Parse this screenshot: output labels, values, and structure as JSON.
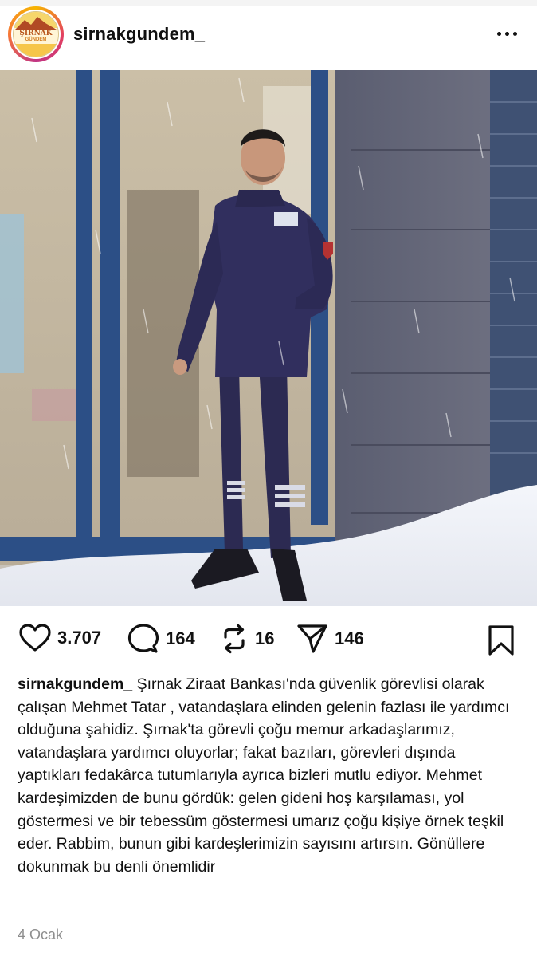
{
  "post": {
    "username": "sirnakgundem_",
    "avatar_text": "ŞIRNAK",
    "avatar_subtext": "GÜNDEM",
    "likes": "3.707",
    "comments": "164",
    "reposts": "16",
    "shares": "146",
    "caption": "Şırnak Ziraat Bankası'nda güvenlik görevlisi olarak çalışan Mehmet Tatar , vatandaşlara elinden gelenin fazlası ile yardımcı olduğuna şahidiz. Şırnak'ta görevli çoğu memur arkadaşlarımız, vatandaşlara yardımcı oluyorlar; fakat bazıları, görevleri dışında yaptıkları fedakârca tutumlarıyla ayrıca bizleri mutlu ediyor. Mehmet kardeşimizden de bunu gördük: gelen gideni hoş karşılaması, yol göstermesi ve bir tebessüm göstermesi umarız çoğu kişiye örnek teşkil eder. Rabbim, bunun gibi kardeşlerimizin sayısını artırsın. Gönüllere dokunmak bu denli önemlidir",
    "date": "4 Ocak"
  },
  "icons": {
    "like": "heart-icon",
    "comment": "comment-icon",
    "repost": "repost-icon",
    "share": "send-icon",
    "save": "bookmark-icon",
    "more": "more-options-icon"
  },
  "colors": {
    "text": "#111111",
    "muted": "#8e8e8e",
    "uniform": "#2f2d5c"
  }
}
